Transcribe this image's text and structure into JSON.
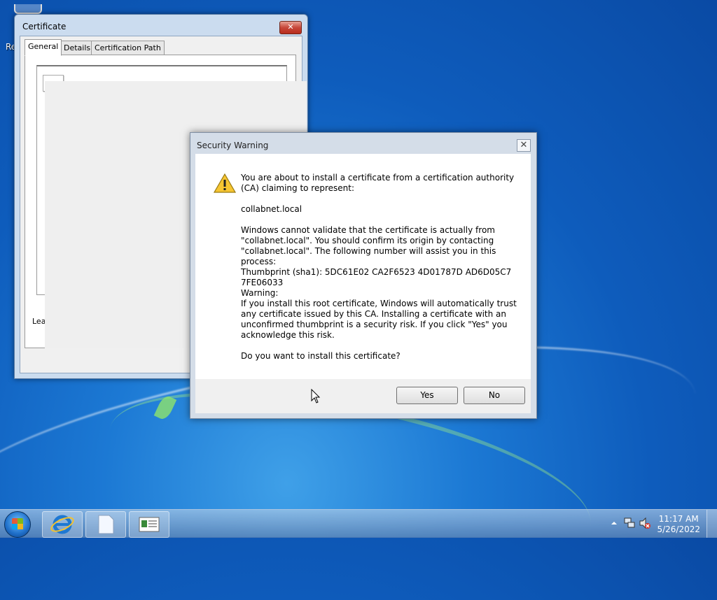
{
  "desktop": {
    "recycle_label": "Re"
  },
  "certificate_window": {
    "title": "Certificate",
    "close_glyph": "✕",
    "tabs": [
      {
        "label": "General"
      },
      {
        "label": "Details"
      },
      {
        "label": "Certification Path"
      }
    ],
    "learn_more_stub": "Lea"
  },
  "security_warning": {
    "title": "Security Warning",
    "close_glyph": "✕",
    "intro": "You are about to install a certificate from a certification authority (CA) claiming to represent:",
    "domain": "collabnet.local",
    "validate": "Windows cannot validate that the certificate is actually from \"collabnet.local\". You should confirm its origin by contacting \"collabnet.local\". The following number will assist you in this process:",
    "thumbprint": "Thumbprint (sha1): 5DC61E02 CA2F6523 4D01787D AD6D05C7 7FE06033",
    "warning_heading": "Warning:",
    "warning_body": "If you install this root certificate, Windows will automatically trust any certificate issued by this CA. Installing a certificate with an unconfirmed thumbprint is a security risk. If you click \"Yes\" you acknowledge this risk.",
    "question": "Do you want to install this certificate?",
    "yes_label": "Yes",
    "no_label": "No",
    "icon": "warning-triangle-icon"
  },
  "taskbar": {
    "pinned": [
      "internet-explorer-icon",
      "document-icon",
      "certificate-manager-icon"
    ],
    "clock_time": "11:17 AM",
    "clock_date": "5/26/2022",
    "tray_icons": [
      "show-hidden-icons-arrow",
      "network-icon",
      "volume-muted-icon"
    ]
  }
}
